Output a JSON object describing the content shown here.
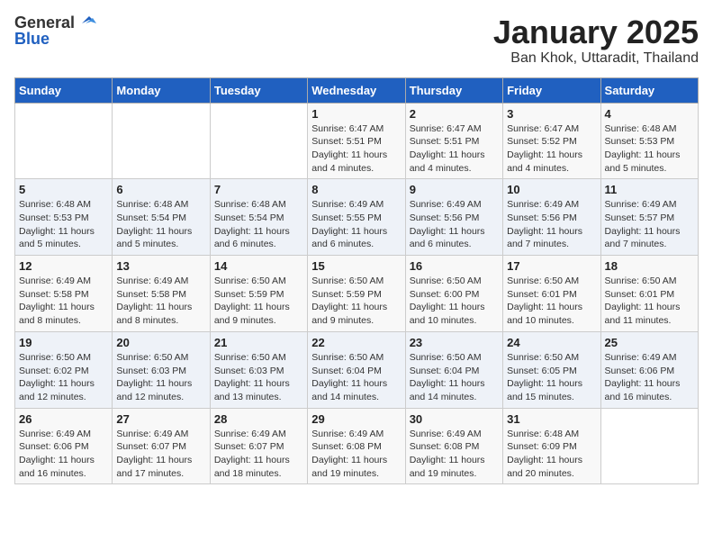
{
  "header": {
    "logo_general": "General",
    "logo_blue": "Blue",
    "title": "January 2025",
    "subtitle": "Ban Khok, Uttaradit, Thailand"
  },
  "weekdays": [
    "Sunday",
    "Monday",
    "Tuesday",
    "Wednesday",
    "Thursday",
    "Friday",
    "Saturday"
  ],
  "weeks": [
    [
      {
        "day": "",
        "sunrise": "",
        "sunset": "",
        "daylight": ""
      },
      {
        "day": "",
        "sunrise": "",
        "sunset": "",
        "daylight": ""
      },
      {
        "day": "",
        "sunrise": "",
        "sunset": "",
        "daylight": ""
      },
      {
        "day": "1",
        "sunrise": "Sunrise: 6:47 AM",
        "sunset": "Sunset: 5:51 PM",
        "daylight": "Daylight: 11 hours and 4 minutes."
      },
      {
        "day": "2",
        "sunrise": "Sunrise: 6:47 AM",
        "sunset": "Sunset: 5:51 PM",
        "daylight": "Daylight: 11 hours and 4 minutes."
      },
      {
        "day": "3",
        "sunrise": "Sunrise: 6:47 AM",
        "sunset": "Sunset: 5:52 PM",
        "daylight": "Daylight: 11 hours and 4 minutes."
      },
      {
        "day": "4",
        "sunrise": "Sunrise: 6:48 AM",
        "sunset": "Sunset: 5:53 PM",
        "daylight": "Daylight: 11 hours and 5 minutes."
      }
    ],
    [
      {
        "day": "5",
        "sunrise": "Sunrise: 6:48 AM",
        "sunset": "Sunset: 5:53 PM",
        "daylight": "Daylight: 11 hours and 5 minutes."
      },
      {
        "day": "6",
        "sunrise": "Sunrise: 6:48 AM",
        "sunset": "Sunset: 5:54 PM",
        "daylight": "Daylight: 11 hours and 5 minutes."
      },
      {
        "day": "7",
        "sunrise": "Sunrise: 6:48 AM",
        "sunset": "Sunset: 5:54 PM",
        "daylight": "Daylight: 11 hours and 6 minutes."
      },
      {
        "day": "8",
        "sunrise": "Sunrise: 6:49 AM",
        "sunset": "Sunset: 5:55 PM",
        "daylight": "Daylight: 11 hours and 6 minutes."
      },
      {
        "day": "9",
        "sunrise": "Sunrise: 6:49 AM",
        "sunset": "Sunset: 5:56 PM",
        "daylight": "Daylight: 11 hours and 6 minutes."
      },
      {
        "day": "10",
        "sunrise": "Sunrise: 6:49 AM",
        "sunset": "Sunset: 5:56 PM",
        "daylight": "Daylight: 11 hours and 7 minutes."
      },
      {
        "day": "11",
        "sunrise": "Sunrise: 6:49 AM",
        "sunset": "Sunset: 5:57 PM",
        "daylight": "Daylight: 11 hours and 7 minutes."
      }
    ],
    [
      {
        "day": "12",
        "sunrise": "Sunrise: 6:49 AM",
        "sunset": "Sunset: 5:58 PM",
        "daylight": "Daylight: 11 hours and 8 minutes."
      },
      {
        "day": "13",
        "sunrise": "Sunrise: 6:49 AM",
        "sunset": "Sunset: 5:58 PM",
        "daylight": "Daylight: 11 hours and 8 minutes."
      },
      {
        "day": "14",
        "sunrise": "Sunrise: 6:50 AM",
        "sunset": "Sunset: 5:59 PM",
        "daylight": "Daylight: 11 hours and 9 minutes."
      },
      {
        "day": "15",
        "sunrise": "Sunrise: 6:50 AM",
        "sunset": "Sunset: 5:59 PM",
        "daylight": "Daylight: 11 hours and 9 minutes."
      },
      {
        "day": "16",
        "sunrise": "Sunrise: 6:50 AM",
        "sunset": "Sunset: 6:00 PM",
        "daylight": "Daylight: 11 hours and 10 minutes."
      },
      {
        "day": "17",
        "sunrise": "Sunrise: 6:50 AM",
        "sunset": "Sunset: 6:01 PM",
        "daylight": "Daylight: 11 hours and 10 minutes."
      },
      {
        "day": "18",
        "sunrise": "Sunrise: 6:50 AM",
        "sunset": "Sunset: 6:01 PM",
        "daylight": "Daylight: 11 hours and 11 minutes."
      }
    ],
    [
      {
        "day": "19",
        "sunrise": "Sunrise: 6:50 AM",
        "sunset": "Sunset: 6:02 PM",
        "daylight": "Daylight: 11 hours and 12 minutes."
      },
      {
        "day": "20",
        "sunrise": "Sunrise: 6:50 AM",
        "sunset": "Sunset: 6:03 PM",
        "daylight": "Daylight: 11 hours and 12 minutes."
      },
      {
        "day": "21",
        "sunrise": "Sunrise: 6:50 AM",
        "sunset": "Sunset: 6:03 PM",
        "daylight": "Daylight: 11 hours and 13 minutes."
      },
      {
        "day": "22",
        "sunrise": "Sunrise: 6:50 AM",
        "sunset": "Sunset: 6:04 PM",
        "daylight": "Daylight: 11 hours and 14 minutes."
      },
      {
        "day": "23",
        "sunrise": "Sunrise: 6:50 AM",
        "sunset": "Sunset: 6:04 PM",
        "daylight": "Daylight: 11 hours and 14 minutes."
      },
      {
        "day": "24",
        "sunrise": "Sunrise: 6:50 AM",
        "sunset": "Sunset: 6:05 PM",
        "daylight": "Daylight: 11 hours and 15 minutes."
      },
      {
        "day": "25",
        "sunrise": "Sunrise: 6:49 AM",
        "sunset": "Sunset: 6:06 PM",
        "daylight": "Daylight: 11 hours and 16 minutes."
      }
    ],
    [
      {
        "day": "26",
        "sunrise": "Sunrise: 6:49 AM",
        "sunset": "Sunset: 6:06 PM",
        "daylight": "Daylight: 11 hours and 16 minutes."
      },
      {
        "day": "27",
        "sunrise": "Sunrise: 6:49 AM",
        "sunset": "Sunset: 6:07 PM",
        "daylight": "Daylight: 11 hours and 17 minutes."
      },
      {
        "day": "28",
        "sunrise": "Sunrise: 6:49 AM",
        "sunset": "Sunset: 6:07 PM",
        "daylight": "Daylight: 11 hours and 18 minutes."
      },
      {
        "day": "29",
        "sunrise": "Sunrise: 6:49 AM",
        "sunset": "Sunset: 6:08 PM",
        "daylight": "Daylight: 11 hours and 19 minutes."
      },
      {
        "day": "30",
        "sunrise": "Sunrise: 6:49 AM",
        "sunset": "Sunset: 6:08 PM",
        "daylight": "Daylight: 11 hours and 19 minutes."
      },
      {
        "day": "31",
        "sunrise": "Sunrise: 6:48 AM",
        "sunset": "Sunset: 6:09 PM",
        "daylight": "Daylight: 11 hours and 20 minutes."
      },
      {
        "day": "",
        "sunrise": "",
        "sunset": "",
        "daylight": ""
      }
    ]
  ]
}
